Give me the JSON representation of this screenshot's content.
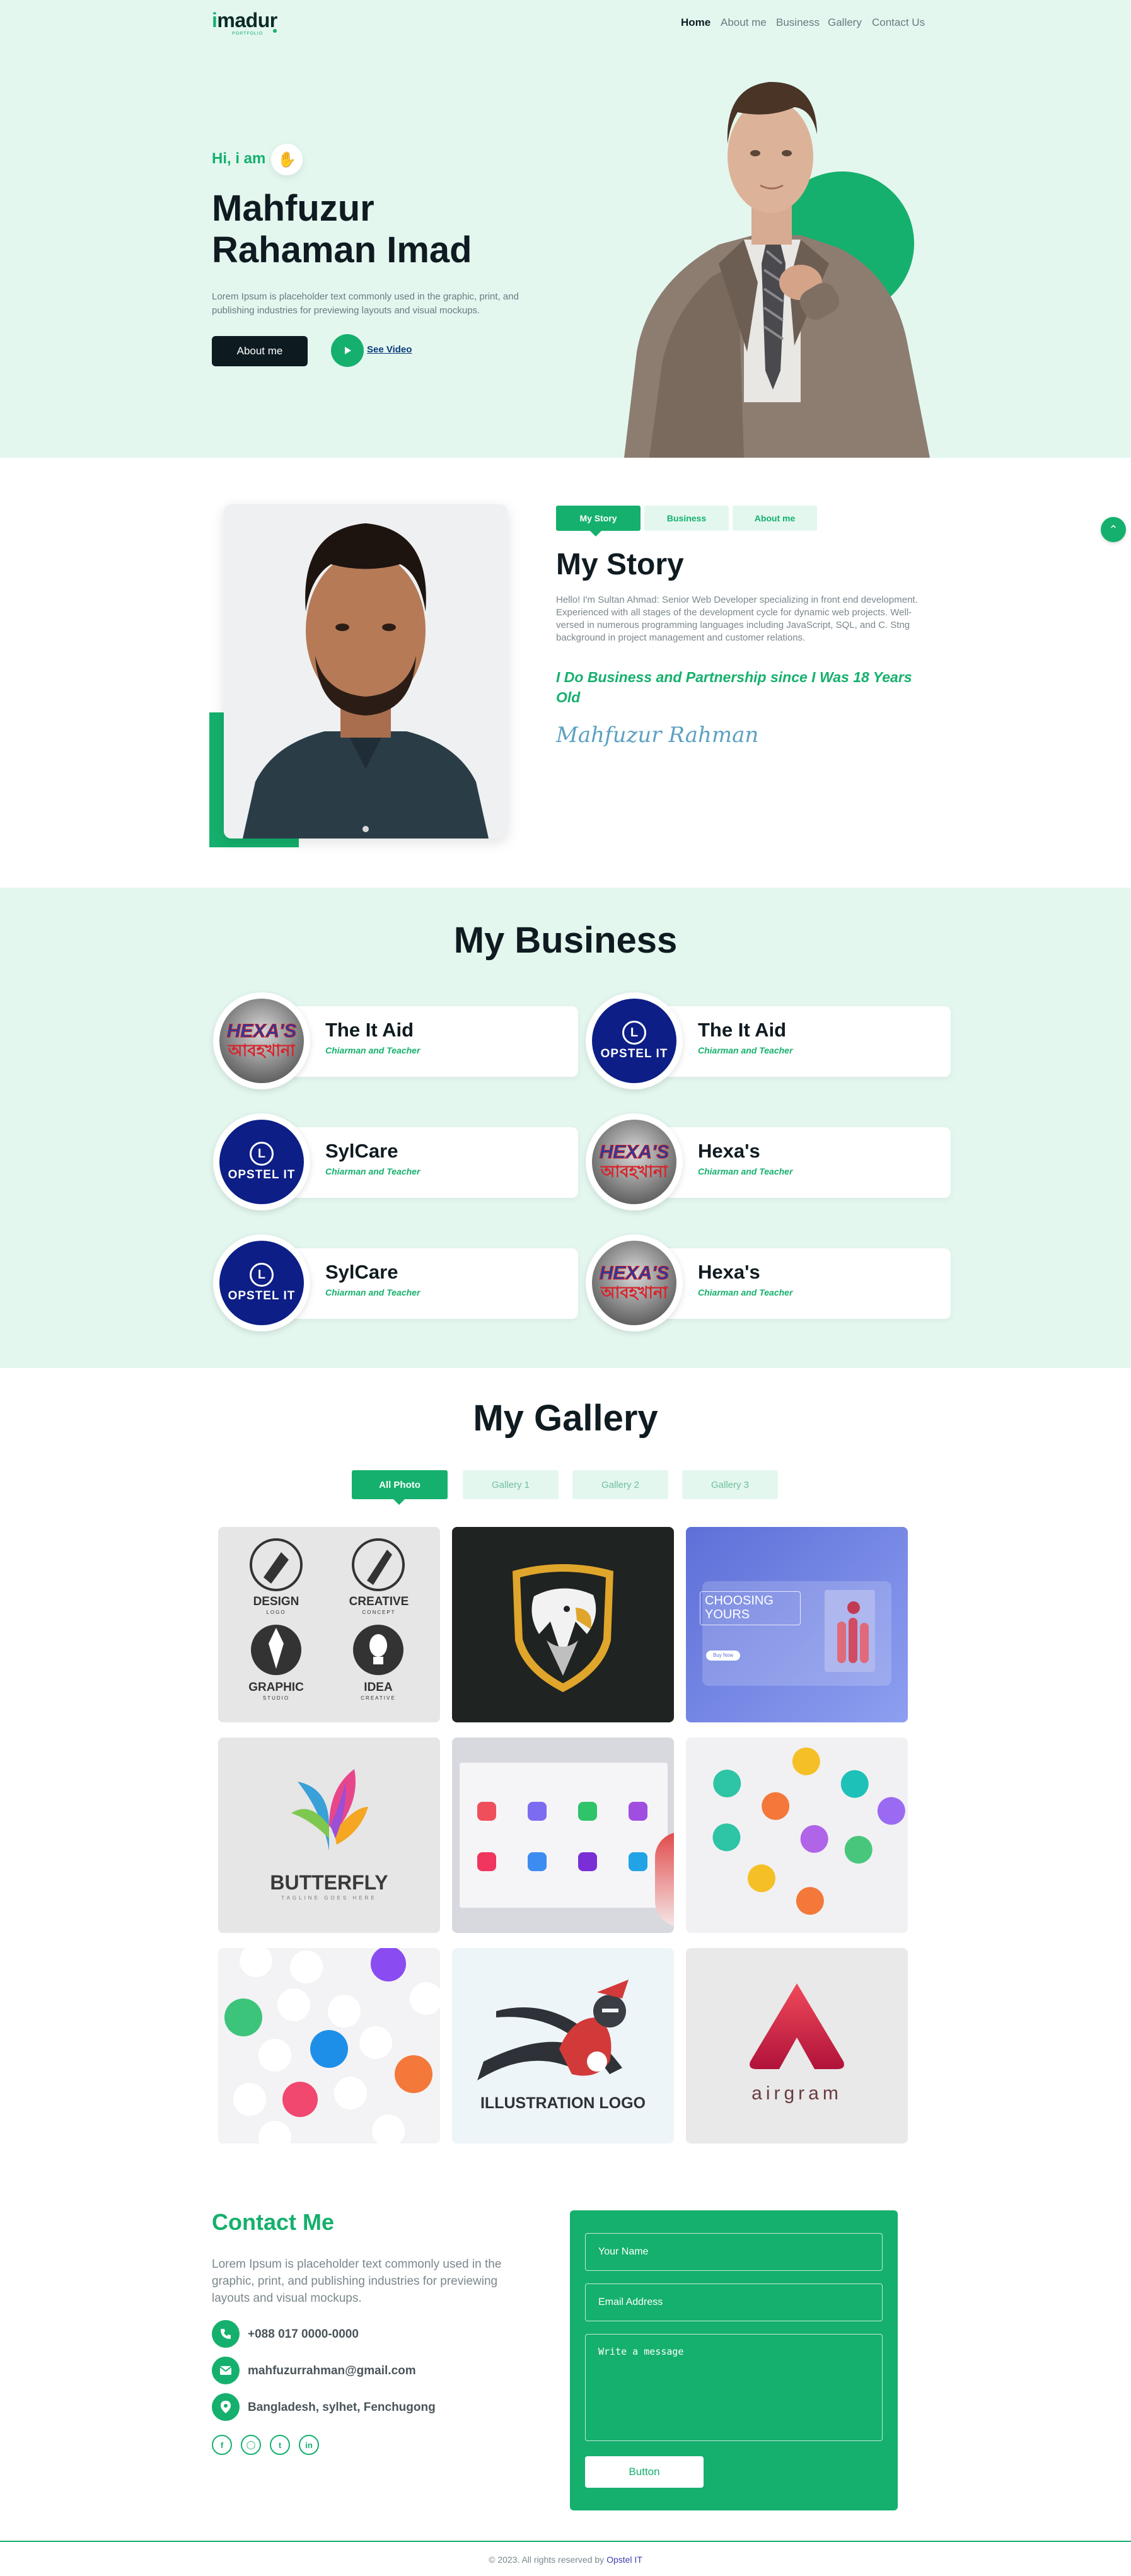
{
  "header": {
    "logo_text": "madur",
    "logo_letter": "i",
    "logo_tagline": "PORTFOLIO",
    "nav": [
      "Home",
      "About me",
      "Business",
      "Gallery",
      "Contact Us"
    ]
  },
  "hero": {
    "greeting": "Hi, i am",
    "name_line1": "Mahfuzur",
    "name_line2": "Rahaman Imad",
    "text": "Lorem Ipsum is placeholder text commonly used in the graphic, print, and publishing industries for previewing layouts and visual mockups.",
    "about_button": "About me",
    "video_link": "See Video",
    "accent": "#15b06d"
  },
  "story": {
    "tabs": [
      "My Story",
      "Business",
      "About me"
    ],
    "title": "My Story",
    "text": "Hello! I'm Sultan Ahmad: Senior Web Developer specializing in front end development. Experienced with all stages of the development cycle for dynamic web projects. Well-versed in numerous programming languages including JavaScript, SQL, and C. Stng background in project management and customer relations.",
    "quote": "I Do Business and Partnership since I Was 18 Years Old",
    "signature": "Mahfuzur Rahman"
  },
  "business": {
    "title": "My Business",
    "items": [
      {
        "name": "The It Aid",
        "role": "Chiarman and Teacher",
        "logo": "hexa",
        "logo_text1": "HEXA'S",
        "logo_text2": "আবহখানা"
      },
      {
        "name": "The It Aid",
        "role": "Chiarman and Teacher",
        "logo": "opstel",
        "logo_text1": "OPSTEL IT",
        "logo_text2": "L"
      },
      {
        "name": "SylCare",
        "role": "Chiarman and Teacher",
        "logo": "opstel",
        "logo_text1": "OPSTEL IT",
        "logo_text2": "L"
      },
      {
        "name": "Hexa's",
        "role": "Chiarman and Teacher",
        "logo": "hexa",
        "logo_text1": "HEXA'S",
        "logo_text2": "আবহখানা"
      },
      {
        "name": "SylCare",
        "role": "Chiarman and Teacher",
        "logo": "opstel",
        "logo_text1": "OPSTEL IT",
        "logo_text2": "L"
      },
      {
        "name": "Hexa's",
        "role": "Chiarman and Teacher",
        "logo": "hexa",
        "logo_text1": "HEXA'S",
        "logo_text2": "আবহখানা"
      }
    ]
  },
  "gallery": {
    "title": "My Gallery",
    "tabs": [
      "All Photo",
      "Gallery 1",
      "Gallery 2",
      "Gallery 3"
    ],
    "img1": {
      "w1": "DESIGN",
      "s1": "LOGO",
      "w2": "CREATIVE",
      "s2": "CONCEPT",
      "w3": "GRAPHIC",
      "s3": "STUDIO",
      "w4": "IDEA",
      "s4": "CREATIVE"
    },
    "img3": {
      "line1": "CHOOSING",
      "line2": "YOURS",
      "btn": "Buy Now"
    },
    "img4": {
      "title": "BUTTERFLY",
      "sub": "TAGLINE GOES HERE"
    },
    "img8": {
      "title": "ILLUSTRATION LOGO"
    },
    "img9": {
      "title": "airgram"
    }
  },
  "contact": {
    "title": "Contact Me",
    "text": "Lorem Ipsum is placeholder text commonly used in the graphic, print, and publishing industries for previewing layouts and visual mockups.",
    "phone": "+088 017 0000-0000",
    "email": "mahfuzurrahman@gmail.com",
    "address": "Bangladesh, sylhet, Fenchugong",
    "form": {
      "name_placeholder": "Your Name",
      "email_placeholder": "Email Address",
      "message_placeholder": "Write a message",
      "button": "Button"
    }
  },
  "footer": {
    "copyright": "© 2023. All rights reserved by",
    "brand": "Opstel IT"
  }
}
